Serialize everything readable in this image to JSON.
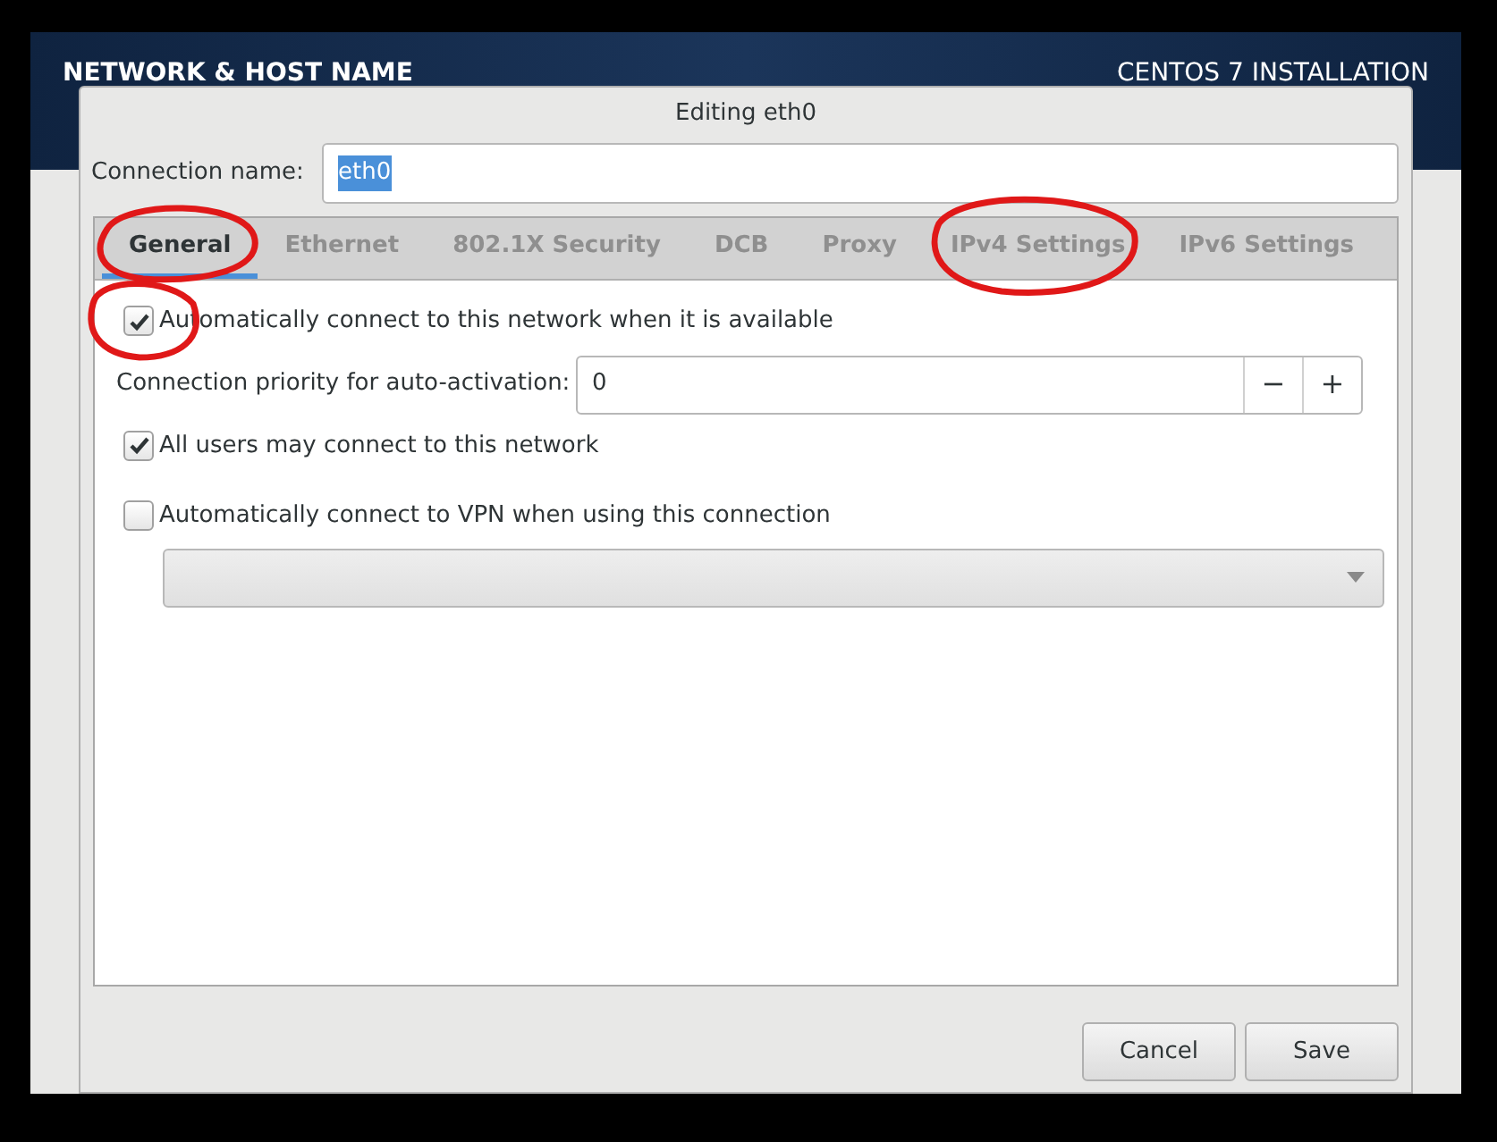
{
  "header": {
    "title": "NETWORK & HOST NAME",
    "product": "CENTOS 7 INSTALLATION"
  },
  "dialog": {
    "title": "Editing eth0",
    "connection_name": {
      "label": "Connection name:",
      "value": "eth0",
      "selected_text": true
    },
    "tabs": [
      {
        "label": "General",
        "selected": true
      },
      {
        "label": "Ethernet",
        "selected": false
      },
      {
        "label": "802.1X Security",
        "selected": false
      },
      {
        "label": "DCB",
        "selected": false
      },
      {
        "label": "Proxy",
        "selected": false
      },
      {
        "label": "IPv4 Settings",
        "selected": false
      },
      {
        "label": "IPv6 Settings",
        "selected": false
      }
    ],
    "general": {
      "auto_connect": {
        "label": "Automatically connect to this network when it is available",
        "checked": true
      },
      "priority": {
        "label": "Connection priority for auto-activation:",
        "value": "0",
        "minus": "−",
        "plus": "+"
      },
      "all_users": {
        "label": "All users may connect to this network",
        "checked": true
      },
      "vpn": {
        "label": "Automatically connect to VPN when using this connection",
        "checked": false
      }
    },
    "buttons": [
      "Cancel",
      "Save"
    ]
  },
  "annotations": [
    {
      "kind": "circle"
    },
    {
      "kind": "circle"
    },
    {
      "kind": "circle"
    }
  ]
}
